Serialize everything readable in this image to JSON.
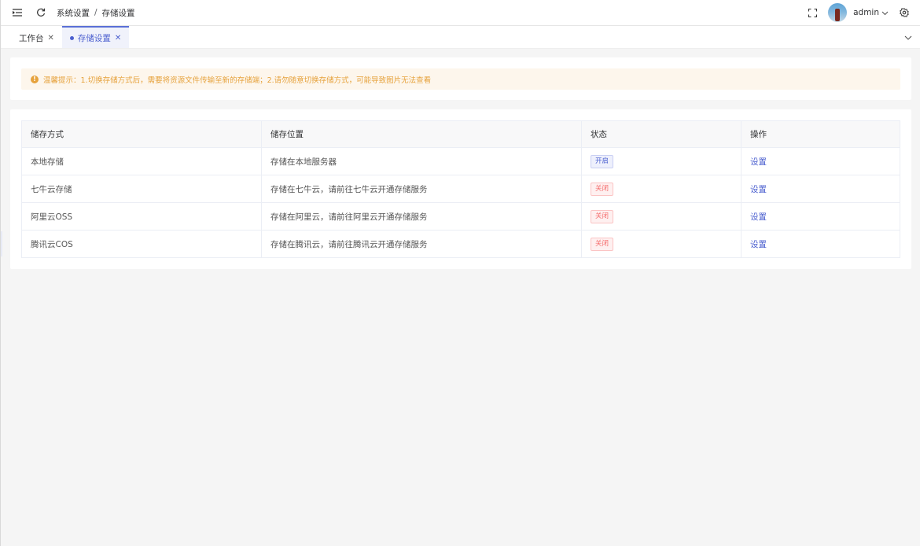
{
  "header": {
    "breadcrumb": [
      "系统设置",
      "存储设置"
    ],
    "breadcrumb_sep": "/",
    "user": "admin"
  },
  "tabs": [
    {
      "label": "工作台",
      "active": false
    },
    {
      "label": "存储设置",
      "active": true
    }
  ],
  "notice": {
    "text": "温馨提示：1.切换存储方式后，需要将资源文件传输至新的存储端；2.请勿随意切换存储方式，可能导致图片无法查看"
  },
  "table": {
    "headers": [
      "储存方式",
      "储存位置",
      "状态",
      "操作"
    ],
    "rows": [
      {
        "method": "本地存储",
        "location": "存储在本地服务器",
        "status": "开启",
        "status_on": true,
        "action": "设置"
      },
      {
        "method": "七牛云存储",
        "location": "存储在七牛云，请前往七牛云开通存储服务",
        "status": "关闭",
        "status_on": false,
        "action": "设置"
      },
      {
        "method": "阿里云OSS",
        "location": "存储在阿里云，请前往阿里云开通存储服务",
        "status": "关闭",
        "status_on": false,
        "action": "设置"
      },
      {
        "method": "腾讯云COS",
        "location": "存储在腾讯云，请前往腾讯云开通存储服务",
        "status": "关闭",
        "status_on": false,
        "action": "设置"
      }
    ]
  },
  "icons": {
    "menu": "menu-fold-icon",
    "refresh": "refresh-icon",
    "fullscreen": "fullscreen-icon",
    "settings": "gear-icon"
  },
  "colors": {
    "primary": "#4b5fcf",
    "warning": "#e6a23c",
    "danger": "#f56c6c"
  }
}
